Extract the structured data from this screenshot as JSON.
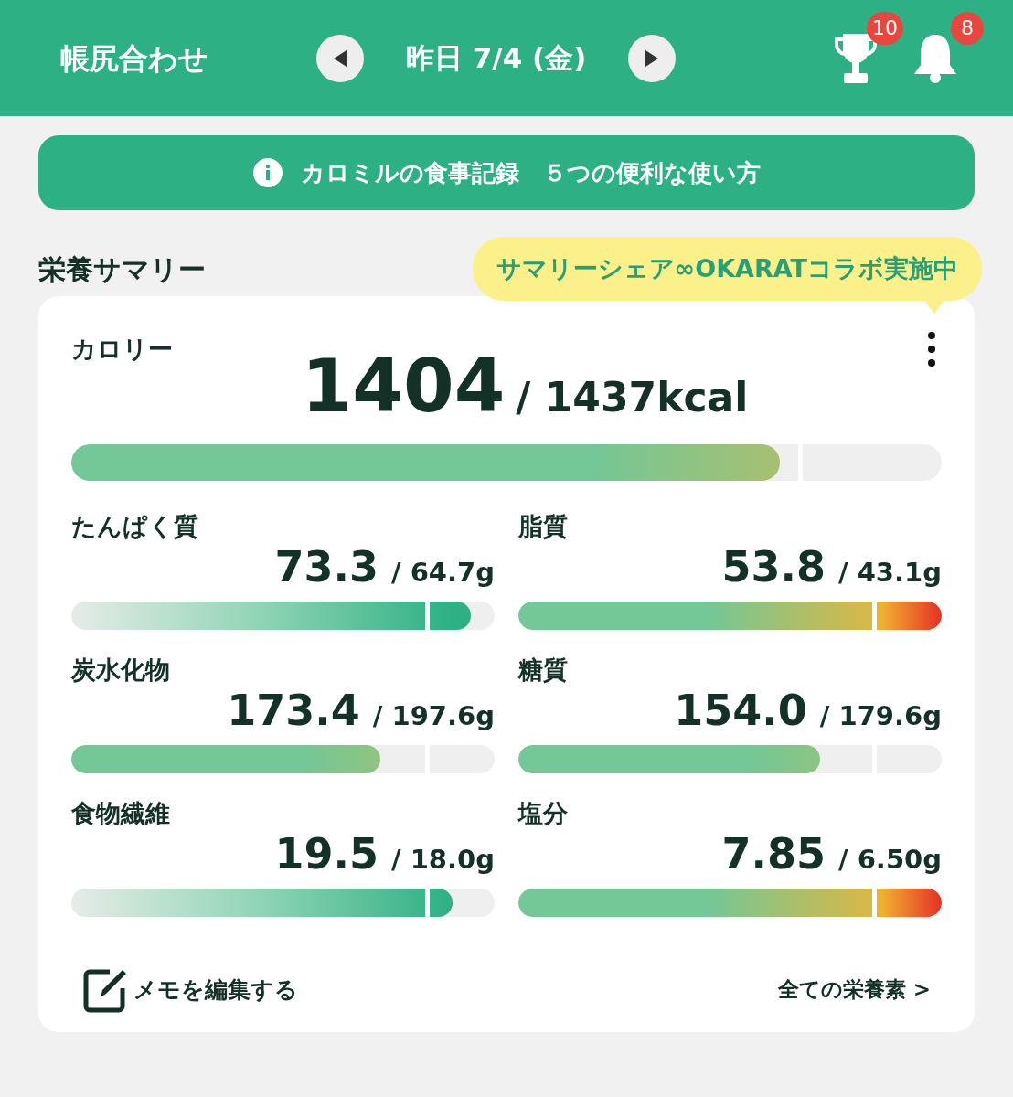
{
  "header": {
    "title": "帳尻合わせ",
    "date": "昨日 7/4 (金)",
    "badges": [
      {
        "kind": "trophy",
        "count": "10"
      },
      {
        "kind": "bell",
        "count": "8"
      }
    ]
  },
  "banner": {
    "text": "カロミルの食事記録　５つの便利な使い方"
  },
  "summary": {
    "heading": "栄養サマリー",
    "tooltip": "サマリーシェア∞OKARATコラボ実施中",
    "calorie": {
      "label": "カロリー",
      "value": "1404",
      "target": "/ 1437kcal",
      "level": 0.814
    },
    "nutrients": [
      {
        "label": "たんぱく質",
        "value": "73.3",
        "target": "/ 64.7g",
        "kind": "goal",
        "level": 0.944
      },
      {
        "label": "脂質",
        "value": "53.8",
        "target": "/ 43.1g",
        "kind": "limit",
        "level": 1
      },
      {
        "label": "炭水化物",
        "value": "173.4",
        "target": "/ 197.6g",
        "kind": "range",
        "level": 0.731
      },
      {
        "label": "糖質",
        "value": "154.0",
        "target": "/ 179.6g",
        "kind": "range",
        "level": 0.713
      },
      {
        "label": "食物繊維",
        "value": "19.5",
        "target": "/ 18.0g",
        "kind": "goal",
        "level": 0.9
      },
      {
        "label": "塩分",
        "value": "7.85",
        "target": "/ 6.50g",
        "kind": "limit",
        "level": 1
      }
    ],
    "memo": "メモを編集する",
    "all_link": "全ての栄養素 >"
  }
}
